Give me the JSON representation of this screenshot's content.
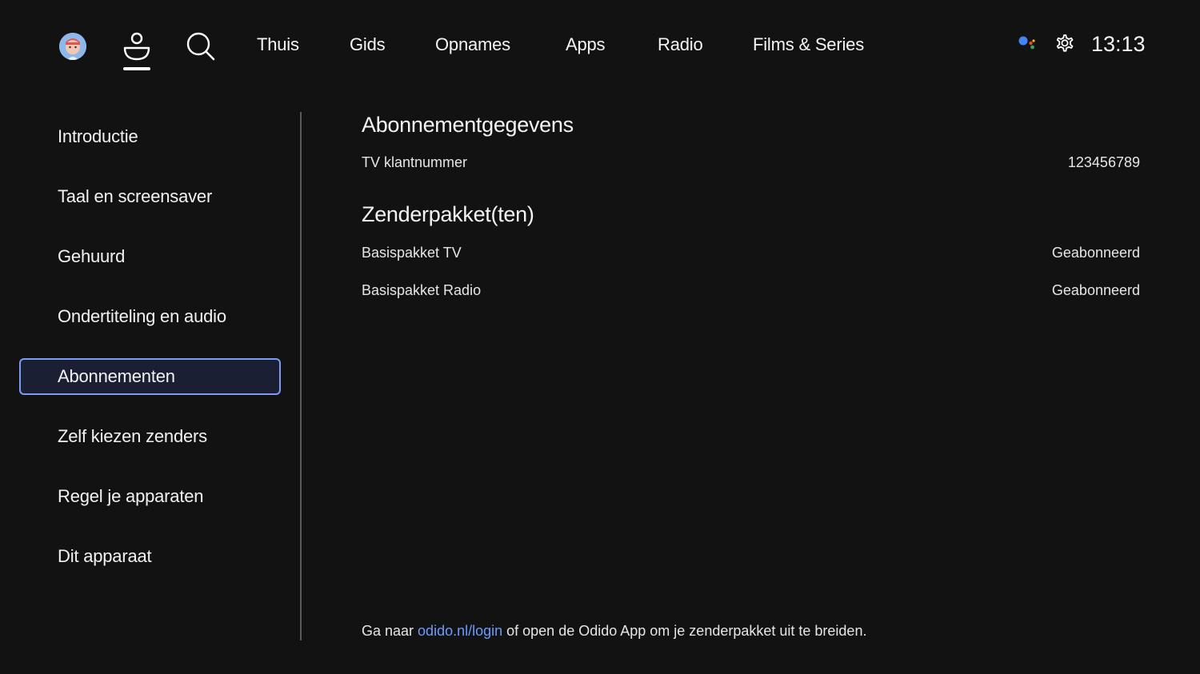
{
  "topnav": {
    "items": [
      "Thuis",
      "Gids",
      "Opnames",
      "Apps",
      "Radio",
      "Films & Series"
    ],
    "clock": "13:13"
  },
  "icons": {
    "avatar": "avatar",
    "profile": "profile-icon",
    "search": "search-icon",
    "assistant": "google-assistant-icon",
    "settings": "gear-icon"
  },
  "sidebar": {
    "items": [
      {
        "label": "Introductie"
      },
      {
        "label": "Taal en screensaver"
      },
      {
        "label": "Gehuurd"
      },
      {
        "label": "Ondertiteling en audio"
      },
      {
        "label": "Abonnementen",
        "selected": true
      },
      {
        "label": "Zelf kiezen zenders"
      },
      {
        "label": "Regel je apparaten"
      },
      {
        "label": "Dit apparaat"
      }
    ]
  },
  "content": {
    "subscription": {
      "title": "Abonnementgegevens",
      "rows": [
        {
          "label": "TV klantnummer",
          "value": "123456789"
        }
      ]
    },
    "packages": {
      "title": "Zenderpakket(ten)",
      "rows": [
        {
          "label": "Basispakket TV",
          "value": "Geabonneerd"
        },
        {
          "label": "Basispakket Radio",
          "value": "Geabonneerd"
        }
      ]
    },
    "footer": {
      "prefix": "Ga naar ",
      "link": "odido.nl/login",
      "suffix": " of open de Odido App om je zenderpakket uit te breiden."
    }
  },
  "colors": {
    "background": "#121212",
    "accent": "#7f9cf5",
    "link": "#6b9bff"
  }
}
